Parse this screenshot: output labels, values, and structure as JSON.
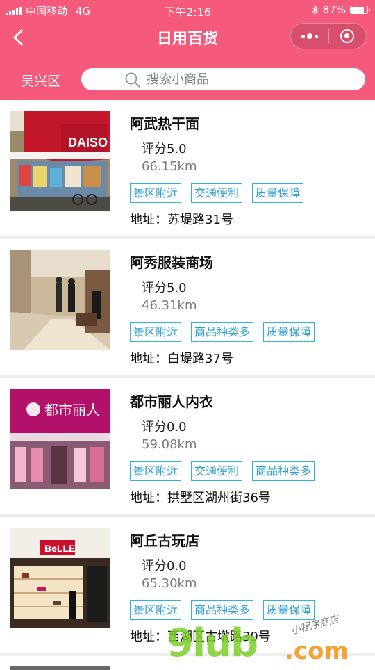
{
  "status_bar": {
    "carrier": "中国移动",
    "network": "4G",
    "time": "下午2:16",
    "battery_text": "87%",
    "battery_level": 0.87
  },
  "nav": {
    "title": "日用百货",
    "back_icon": "chevron-left-icon",
    "more_icon": "more-dots-icon",
    "close_icon": "target-circle-icon"
  },
  "search": {
    "district": "吴兴区",
    "placeholder": "搜索小商品",
    "icon": "search-icon"
  },
  "colors": {
    "brand": "#f55a7d",
    "tag_border": "#2fb3e0",
    "tag_text": "#2a9fd0"
  },
  "stores": [
    {
      "name": "阿武热干面",
      "rating": "评分5.0",
      "distance": "66.15km",
      "tags": [
        "景区附近",
        "交通便利",
        "质量保障"
      ],
      "address": "地址：苏堤路31号",
      "image_text": "DAISO"
    },
    {
      "name": "阿秀服装商场",
      "rating": "评分5.0",
      "distance": "46.31km",
      "tags": [
        "景区附近",
        "商品种类多",
        "质量保障"
      ],
      "address": "地址：白堤路37号",
      "image_text": ""
    },
    {
      "name": "都市丽人内衣",
      "rating": "评分0.0",
      "distance": "59.08km",
      "tags": [
        "景区附近",
        "交通便利",
        "商品种类多"
      ],
      "address": "地址：拱墅区湖州街36号",
      "image_text": "都市丽人"
    },
    {
      "name": "阿丘古玩店",
      "rating": "评分0.0",
      "distance": "65.30km",
      "tags": [
        "景区附近",
        "商品种类多",
        "质量保障"
      ],
      "address": "地址：西湖区古墩路39号",
      "image_text": "BeLLE"
    }
  ],
  "watermark": {
    "main": "9lub",
    "suffix": ".com",
    "cn": "小程序商店"
  }
}
